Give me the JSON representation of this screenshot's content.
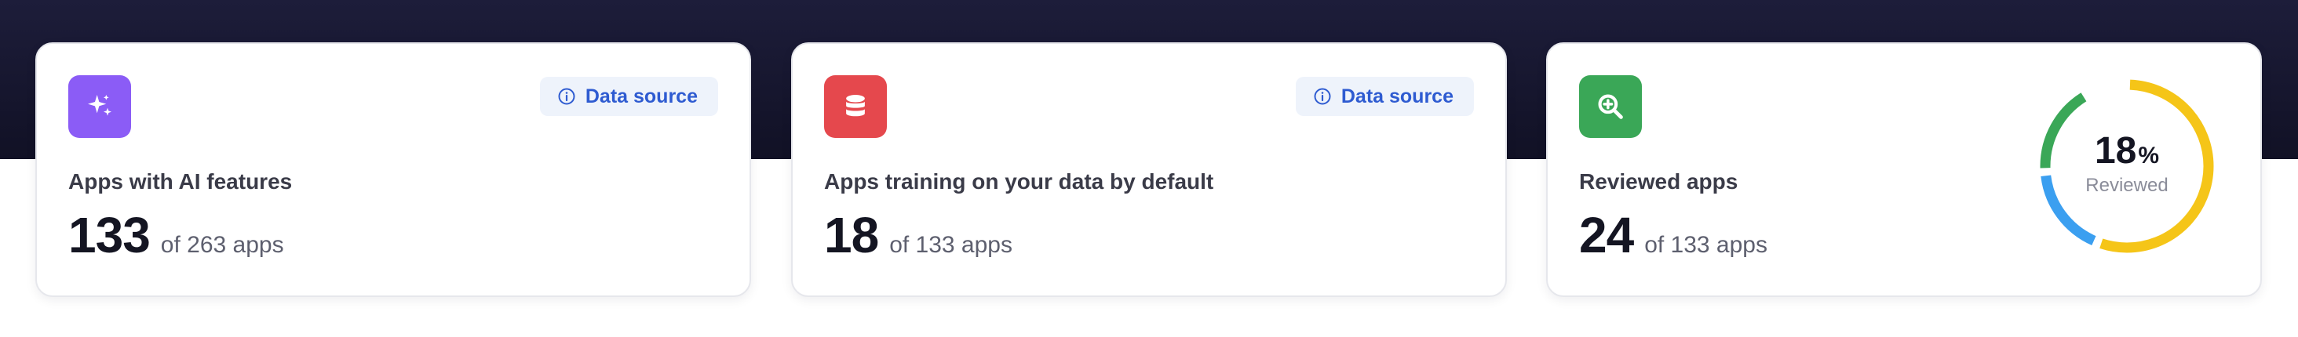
{
  "cards": [
    {
      "label": "Apps with AI features",
      "count": "133",
      "total": "of 263 apps",
      "icon": "sparkles-icon",
      "tile_color": "#8b5cf6",
      "source_label": "Data source"
    },
    {
      "label": "Apps training on your data by default",
      "count": "18",
      "total": "of 133 apps",
      "icon": "database-icon",
      "tile_color": "#e5484d",
      "source_label": "Data source"
    },
    {
      "label": "Reviewed apps",
      "count": "24",
      "total": "of 133 apps",
      "icon": "zoom-search-icon",
      "tile_color": "#3aa757"
    }
  ],
  "donut": {
    "percent": "18",
    "percent_symbol": "%",
    "label": "Reviewed",
    "segments": [
      {
        "fraction": 0.56,
        "color": "#f5c518"
      },
      {
        "fraction": 0.18,
        "color": "#3b9ff0"
      },
      {
        "fraction": 0.18,
        "color": "#3aa757"
      }
    ]
  },
  "colors": {
    "header_band": "#15152c",
    "accent_link": "#2e5bd1"
  }
}
